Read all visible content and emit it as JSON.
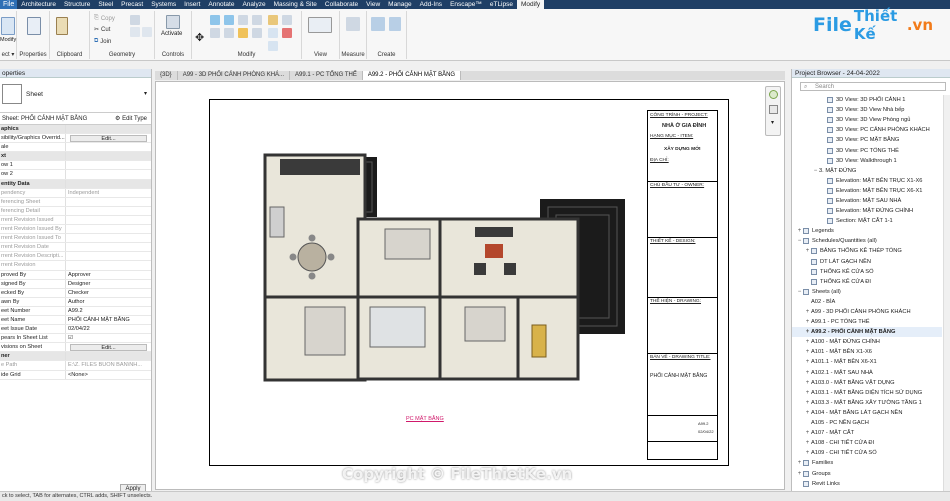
{
  "menu": {
    "file": "File",
    "items": [
      "Architecture",
      "Structure",
      "Steel",
      "Precast",
      "Systems",
      "Insert",
      "Annotate",
      "Analyze",
      "Massing & Site",
      "Collaborate",
      "View",
      "Manage",
      "Add-Ins",
      "Enscape™",
      "eTLipse",
      "Modify"
    ]
  },
  "ribbon": {
    "groups": {
      "select": "ect ▾",
      "properties": "Properties",
      "clipboard": "Clipboard",
      "geometry": "Geometry",
      "controls": "Controls",
      "modify": "Modify",
      "view": "View",
      "measure": "Measure",
      "create": "Create"
    },
    "modify_btn": "Modify",
    "copy": "Copy",
    "cut": "Cut",
    "join": "Join",
    "activate": "Activate"
  },
  "logo": {
    "brand_a": "File",
    "brand_b": "Thiết Kế",
    "brand_c": ".vn"
  },
  "properties": {
    "title": "operties",
    "type_name": "Sheet",
    "filter": "Sheet: PHỐI CẢNH MẶT BẰNG",
    "edit_type": "Edit Type",
    "rows": [
      {
        "k": "aphics",
        "v": "",
        "hdr": true
      },
      {
        "k": "sibility/Graphics Overrid...",
        "v": "Edit...",
        "btn": true
      },
      {
        "k": "ale",
        "v": ""
      },
      {
        "k": "xt",
        "v": "",
        "hdr": true
      },
      {
        "k": "ow 1",
        "v": ""
      },
      {
        "k": "ow 2",
        "v": ""
      },
      {
        "k": "entity Data",
        "v": "",
        "hdr": true
      },
      {
        "k": "pendency",
        "v": "Independent",
        "dim": true
      },
      {
        "k": "ferencing Sheet",
        "v": "",
        "dim": true
      },
      {
        "k": "ferencing Detail",
        "v": "",
        "dim": true
      },
      {
        "k": "rrent Revision Issued",
        "v": "",
        "dim": true
      },
      {
        "k": "rrent Revision Issued By",
        "v": "",
        "dim": true
      },
      {
        "k": "rrent Revision Issued To",
        "v": "",
        "dim": true
      },
      {
        "k": "rrent Revision Date",
        "v": "",
        "dim": true
      },
      {
        "k": "rrent Revision Descripti...",
        "v": "",
        "dim": true
      },
      {
        "k": "rrent Revision",
        "v": "",
        "dim": true
      },
      {
        "k": "proved By",
        "v": "Approver"
      },
      {
        "k": "signed By",
        "v": "Designer"
      },
      {
        "k": "ecked By",
        "v": "Checker"
      },
      {
        "k": "awn By",
        "v": "Author"
      },
      {
        "k": "eet Number",
        "v": "A99.2"
      },
      {
        "k": "eet Name",
        "v": "PHỐI CẢNH MẶT BẰNG"
      },
      {
        "k": "eet Issue Date",
        "v": "02/04/22"
      },
      {
        "k": "pears In Sheet List",
        "v": "☑"
      },
      {
        "k": "visions on Sheet",
        "v": "Edit...",
        "btn": true
      },
      {
        "k": "ner",
        "v": "",
        "hdr": true
      },
      {
        "k": "e Path",
        "v": "E:\\Z. FILES BUON BAN\\NH...",
        "dim": true
      },
      {
        "k": "ide Grid",
        "v": "<None>"
      }
    ],
    "apply": "Apply"
  },
  "tabs": [
    {
      "label": "{3D}",
      "active": false
    },
    {
      "label": "A99 - 3D PHỐI CẢNH PHÒNG KHÁ...",
      "active": false
    },
    {
      "label": "A99.1 - PC TỔNG THỂ",
      "active": false
    },
    {
      "label": "A99.2 - PHỐI CẢNH MẶT BẰNG",
      "active": true
    }
  ],
  "titleblock": {
    "project_label": "CÔNG TRÌNH - PROJECT:",
    "project": "NHÀ Ở GIA ĐÌNH",
    "item_label": "HẠNG MỤC - ITEM:",
    "item": "XÂY DỰNG MỚI",
    "addr": "ĐỊA CHỈ:",
    "owner": "CHỦ ĐẦU TƯ - OWNER:",
    "design": "THIẾT KẾ - DESIGN:",
    "drawing": "THỂ HIỆN - DRAWING:",
    "drawing_title_label": "BẢN VẼ - DRAWING TITLE:",
    "drawing_title": "PHỐI CẢNH MẶT BẰNG",
    "sheet_no": "A99.2",
    "date": "02/04/22"
  },
  "caption": "PC MẶT BẰNG",
  "browser": {
    "title": "Project Browser - 24-04-2022",
    "search": "Search",
    "items": [
      {
        "t": "3D View: 3D PHỐI CẢNH 1",
        "lvl": 3,
        "icon": true
      },
      {
        "t": "3D View: 3D View Nhà bếp",
        "lvl": 3,
        "icon": true
      },
      {
        "t": "3D View: 3D View Phòng ngủ",
        "lvl": 3,
        "icon": true
      },
      {
        "t": "3D View: PC CẢNH PHÒNG KHÁCH",
        "lvl": 3,
        "icon": true
      },
      {
        "t": "3D View: PC MẶT BẰNG",
        "lvl": 3,
        "icon": true
      },
      {
        "t": "3D View: PC TỔNG THỂ",
        "lvl": 3,
        "icon": true
      },
      {
        "t": "3D View: Walkthrough 1",
        "lvl": 3,
        "icon": true
      },
      {
        "t": "3. MẶT ĐỨNG",
        "lvl": 2,
        "tw": "−"
      },
      {
        "t": "Elevation: MẶT BÊN TRỤC X1-X6",
        "lvl": 3,
        "icon": true
      },
      {
        "t": "Elevation: MẶT BÊN TRỤC X6-X1",
        "lvl": 3,
        "icon": true
      },
      {
        "t": "Elevation: MẶT SAU NHÀ",
        "lvl": 3,
        "icon": true
      },
      {
        "t": "Elevation: MẶT ĐỨNG CHÍNH",
        "lvl": 3,
        "icon": true
      },
      {
        "t": "Section: MẶT CẮT 1-1",
        "lvl": 3,
        "icon": true
      },
      {
        "t": "Legends",
        "lvl": 0,
        "tw": "+",
        "icon": true
      },
      {
        "t": "Schedules/Quantities (all)",
        "lvl": 0,
        "tw": "−",
        "icon": true
      },
      {
        "t": "BẢNG THỐNG KÊ THÉP TỔNG",
        "lvl": 1,
        "tw": "+",
        "icon": true
      },
      {
        "t": "DT LÁT GẠCH NỀN",
        "lvl": 1,
        "icon": true
      },
      {
        "t": "THỐNG KÊ CỬA SỔ",
        "lvl": 1,
        "icon": true
      },
      {
        "t": "THỐNG KÊ CỬA ĐI",
        "lvl": 1,
        "icon": true
      },
      {
        "t": "Sheets (all)",
        "lvl": 0,
        "tw": "−",
        "icon": true
      },
      {
        "t": "A02 - BÌA",
        "lvl": 1
      },
      {
        "t": "A99 - 3D PHỐI CẢNH PHÒNG KHÁCH",
        "lvl": 1,
        "tw": "+"
      },
      {
        "t": "A99.1 - PC TỔNG THỂ",
        "lvl": 1,
        "tw": "+"
      },
      {
        "t": "A99.2 - PHỐI CẢNH MẶT BẰNG",
        "lvl": 1,
        "tw": "+",
        "bold": true,
        "sel": true
      },
      {
        "t": "A100 - MẶT ĐỨNG CHÍNH",
        "lvl": 1,
        "tw": "+"
      },
      {
        "t": "A101 - MẶT BÊN X1-X6",
        "lvl": 1,
        "tw": "+"
      },
      {
        "t": "A101.1 - MẶT BÊN X6-X1",
        "lvl": 1,
        "tw": "+"
      },
      {
        "t": "A102.1 - MẶT SAU NHÀ",
        "lvl": 1,
        "tw": "+"
      },
      {
        "t": "A103.0 - MẶT BẰNG VẬT DỤNG",
        "lvl": 1,
        "tw": "+"
      },
      {
        "t": "A103.1 - MẶT BẰNG DIỆN TÍCH SỬ DỤNG",
        "lvl": 1,
        "tw": "+"
      },
      {
        "t": "A103.3 - MẶT BẰNG XÂY TƯỜNG TẦNG 1",
        "lvl": 1,
        "tw": "+"
      },
      {
        "t": "A104 - MẶT BẰNG LÁT GẠCH NỀN",
        "lvl": 1,
        "tw": "+"
      },
      {
        "t": "A105 - PC NỀN GẠCH",
        "lvl": 1
      },
      {
        "t": "A107 - MẶT CẮT",
        "lvl": 1,
        "tw": "+"
      },
      {
        "t": "A108 - CHI TIẾT CỬA ĐI",
        "lvl": 1,
        "tw": "+"
      },
      {
        "t": "A109 - CHI TIẾT CỬA SỔ",
        "lvl": 1,
        "tw": "+"
      },
      {
        "t": "Families",
        "lvl": 0,
        "tw": "+",
        "icon": true
      },
      {
        "t": "Groups",
        "lvl": 0,
        "tw": "+",
        "icon": true
      },
      {
        "t": "Revit Links",
        "lvl": 0,
        "icon": true
      }
    ]
  },
  "status": "ck to select, TAB for alternates, CTRL adds, SHIFT unselects.",
  "watermark": "Copyright © FileThietKe.vn",
  "colors": {
    "accent": "#1f3f66",
    "brand_blue": "#2b9be3",
    "brand_orange": "#f27b1a",
    "caption": "#d0196b"
  }
}
